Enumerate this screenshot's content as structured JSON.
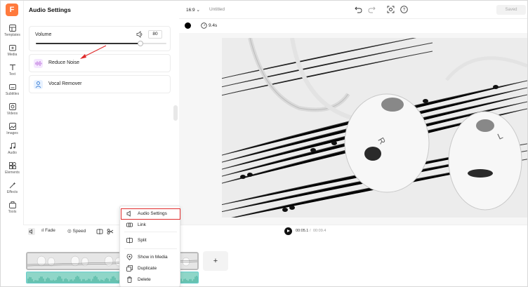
{
  "app": {
    "logo_letter": "F"
  },
  "rail": {
    "items": [
      {
        "label": "Templates",
        "icon": "templates-icon"
      },
      {
        "label": "Media",
        "icon": "media-icon"
      },
      {
        "label": "Text",
        "icon": "text-icon"
      },
      {
        "label": "Subtitles",
        "icon": "subtitles-icon"
      },
      {
        "label": "Videos",
        "icon": "videos-icon"
      },
      {
        "label": "Images",
        "icon": "images-icon"
      },
      {
        "label": "Audio",
        "icon": "audio-icon"
      },
      {
        "label": "Elements",
        "icon": "elements-icon"
      },
      {
        "label": "Effects",
        "icon": "effects-icon"
      },
      {
        "label": "Tools",
        "icon": "tools-icon"
      }
    ]
  },
  "panel": {
    "title": "Audio Settings",
    "volume": {
      "label": "Volume",
      "value": "80",
      "level": 0.8
    },
    "options": [
      {
        "label": "Reduce Noise",
        "icon": "waveform-icon",
        "color": "#f5e8ff"
      },
      {
        "label": "Vocal Remover",
        "icon": "person-icon",
        "color": "#e8f2ff"
      }
    ]
  },
  "topbar": {
    "ratio": "16:9",
    "doc_title": "Untitled",
    "saved_label": "Saved"
  },
  "canvas": {
    "duration": "9.4s"
  },
  "timeline": {
    "fade_label": "Fade",
    "speed_label": "Speed",
    "current_time": "00:05.1",
    "separator": "/",
    "total_time": "00:09.4",
    "add_label": "+"
  },
  "context_menu": {
    "items": [
      {
        "label": "Audio Settings",
        "icon": "speaker-icon"
      },
      {
        "label": "Link",
        "icon": "link-icon"
      },
      {
        "label": "Split",
        "icon": "split-icon"
      },
      {
        "label": "Show in Media",
        "icon": "location-icon"
      },
      {
        "label": "Duplicate",
        "icon": "duplicate-icon"
      },
      {
        "label": "Delete",
        "icon": "trash-icon"
      }
    ]
  },
  "colors": {
    "accent": "#ff7a3d",
    "highlight": "#e02b2b"
  }
}
